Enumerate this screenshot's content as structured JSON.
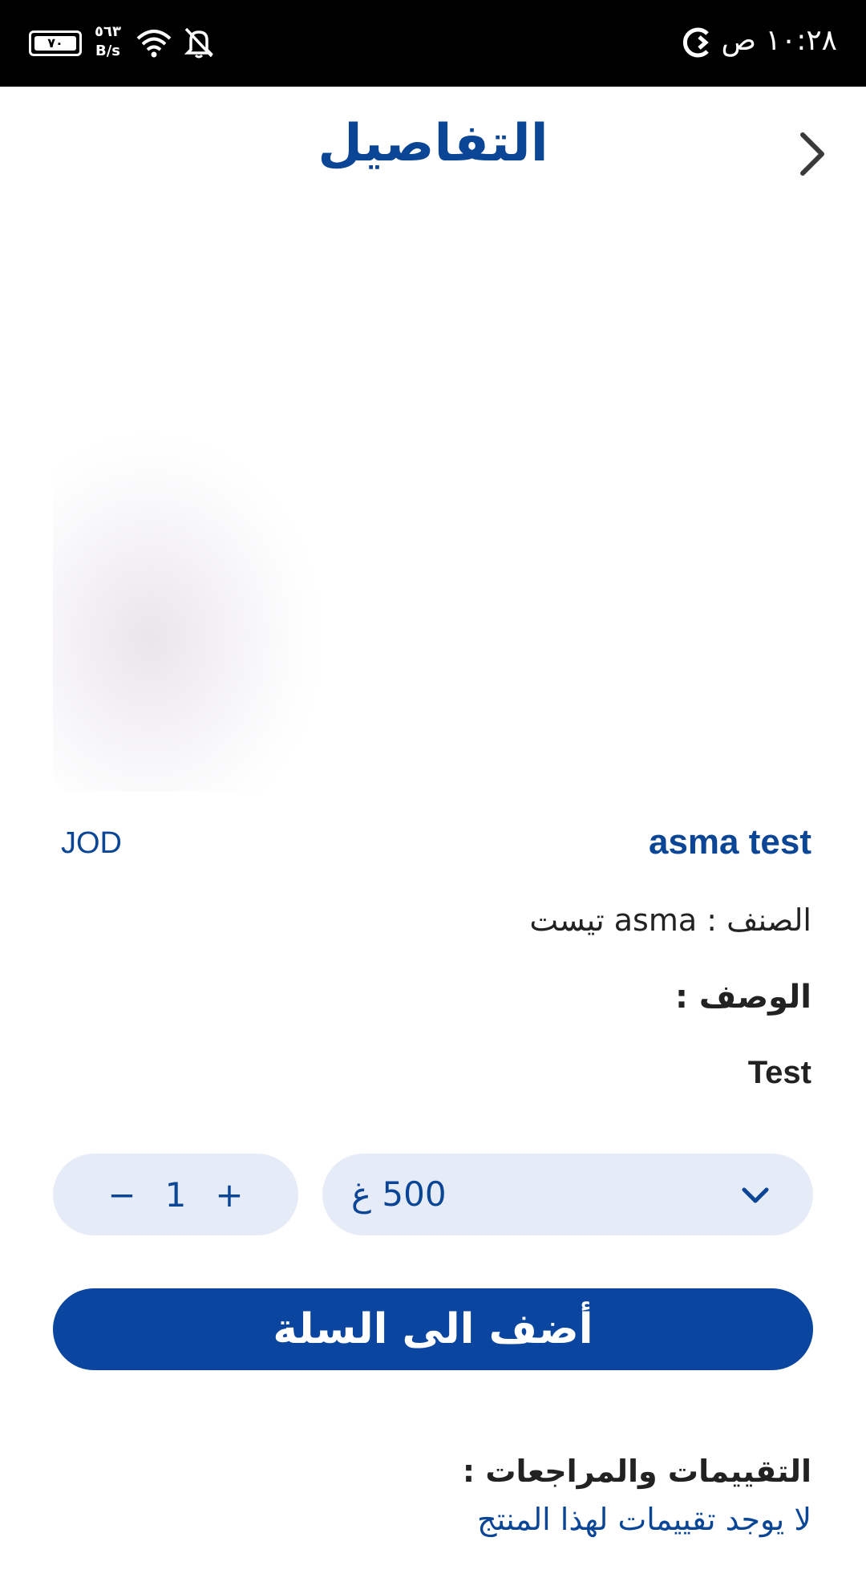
{
  "status_bar": {
    "time": "١٠:٢٨ ص",
    "battery": "٧٠",
    "speed_value": "٥٦٣",
    "speed_unit": "B/s"
  },
  "header": {
    "title": "التفاصيل"
  },
  "product": {
    "name": "asma test",
    "currency": "JOD",
    "category_line": "الصنف : asma تيست",
    "description_label": "الوصف :",
    "description": "Test"
  },
  "controls": {
    "qty_minus": "−",
    "qty_value": "1",
    "qty_plus": "+",
    "weight_value": "500 غ"
  },
  "cart": {
    "add_label": "أضف الى السلة"
  },
  "reviews": {
    "title": "التقييمات والمراجعات :",
    "empty_message": "لا يوجد تقييمات لهذا المنتج"
  },
  "colors": {
    "brand": "#0a4596",
    "control_bg": "#e6ecf7"
  }
}
